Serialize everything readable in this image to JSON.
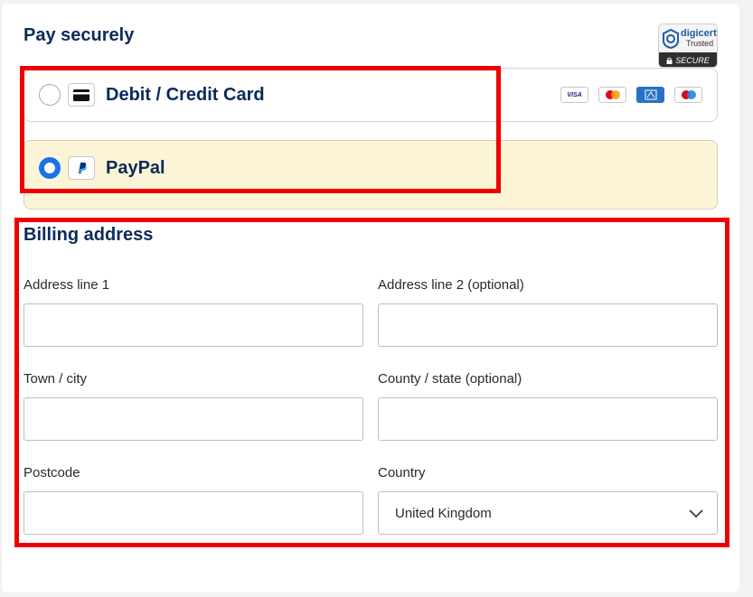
{
  "page": {
    "heading": "Pay securely"
  },
  "trust_badge": {
    "brand": "digicert",
    "trusted": "Trusted",
    "secure": "SECURE",
    "icon": "digicert-logo-icon"
  },
  "payment_options": [
    {
      "label": "Debit / Credit Card",
      "selected": false,
      "icon": "credit-card-icon",
      "brands": [
        "VISA",
        "mastercard",
        "AMEX",
        "maestro"
      ]
    },
    {
      "label": "PayPal",
      "selected": true,
      "icon": "paypal-icon"
    }
  ],
  "billing": {
    "title": "Billing address",
    "fields": {
      "address1": {
        "label": "Address line 1",
        "value": ""
      },
      "address2": {
        "label": "Address line 2 (optional)",
        "value": ""
      },
      "town": {
        "label": "Town / city",
        "value": ""
      },
      "county": {
        "label": "County / state (optional)",
        "value": ""
      },
      "postcode": {
        "label": "Postcode",
        "value": ""
      },
      "country": {
        "label": "Country",
        "value": "United Kingdom",
        "icon": "chevron-down-icon"
      }
    }
  },
  "colors": {
    "heading": "#0b2a5b",
    "radio_selected": "#1a73e8",
    "paypal_bg": "#fbf4d7",
    "highlight": "#ee0000"
  }
}
